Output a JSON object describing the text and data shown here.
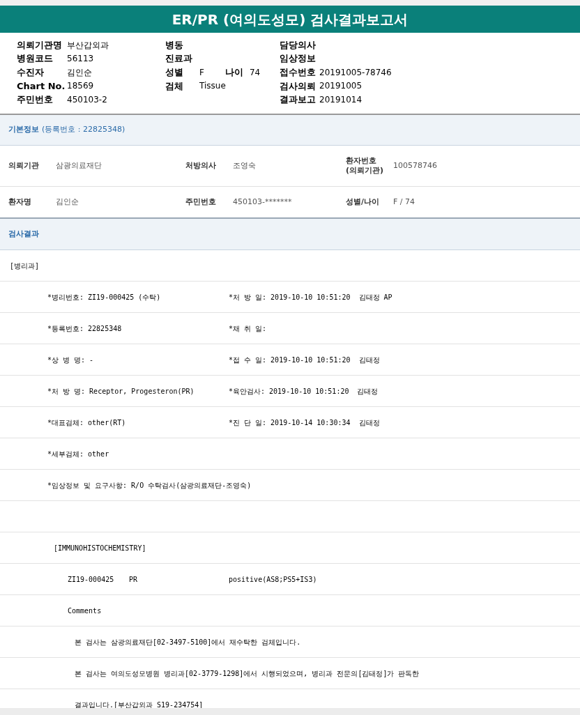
{
  "title": "ER/PR (여의도성모) 검사결과보고서",
  "header": {
    "rows": [
      [
        {
          "label": "의뢰기관명",
          "value": "부산갑외과"
        },
        {
          "label": "병동"
        },
        {
          "label": "담당의사"
        }
      ],
      [
        {
          "label": "병원코드",
          "value": "56113"
        },
        {
          "label": "진료과"
        },
        {
          "label": "임상정보"
        }
      ],
      [
        {
          "label": "수진자",
          "value": "김인순"
        },
        {
          "label": "성별",
          "value": "F",
          "extra_label": "나이",
          "extra_value": "74"
        },
        {
          "label": "접수번호",
          "value": "20191005-78746"
        }
      ],
      [
        {
          "label": "Chart No.",
          "value": "18569"
        },
        {
          "label": "검체",
          "value": "Tissue"
        },
        {
          "label": "검사의뢰",
          "value": "20191005"
        }
      ],
      [
        {
          "label": "주민번호",
          "value": "450103-2"
        },
        {},
        {
          "label": "결과보고",
          "value": "20191014"
        }
      ]
    ]
  },
  "basic_info": {
    "heading": "기본정보",
    "note": "(등록번호 : 22825348)",
    "rows": [
      [
        {
          "label": "의뢰기관",
          "value": "삼광의료재단"
        },
        {
          "label": "처방의사",
          "value": "조영숙"
        },
        {
          "label": "환자번호\n(의뢰기관)",
          "value": "100578746"
        }
      ],
      [
        {
          "label": "환자명",
          "value": "김인순"
        },
        {
          "label": "주민번호",
          "value": "450103-*******"
        },
        {
          "label": "성별/나이",
          "value": "F / 74"
        }
      ]
    ]
  },
  "results": {
    "heading": "검사결과",
    "lines": [
      {
        "kind": "department",
        "text": "[병리과]"
      },
      {
        "kind": "pair",
        "left": "*병리번호: ZI19-000425 (수탁)",
        "right": "*처 방 일: 2019-10-10 10:51:20  김태정 AP"
      },
      {
        "kind": "pair",
        "left": "*등록번호: 22825348",
        "right": "*채 취 일:"
      },
      {
        "kind": "pair",
        "left": "*상 병 명: -",
        "right": "*접 수 일: 2019-10-10 10:51:20  김태정"
      },
      {
        "kind": "pair",
        "left": "*처 방 명: Receptor, Progesteron(PR)",
        "right": "*육안검사: 2019-10-10 10:51:20  김태정"
      },
      {
        "kind": "pair",
        "left": "*대표검체: other(RT)",
        "right": "*진 단 일: 2019-10-14 10:30:34  김태정"
      },
      {
        "kind": "pair",
        "left": "*세부검체: other"
      },
      {
        "kind": "pair",
        "left": "*임상정보 및 요구사항: R/O 수탁검사(삼광의료재단-조영숙)"
      },
      {
        "kind": "blank"
      },
      {
        "kind": "group",
        "text": "[IMMUNOHISTOCHEMISTRY]"
      },
      {
        "kind": "result",
        "cells": [
          "ZI19-000425",
          "PR",
          "positive(AS8;PS5+IS3)"
        ]
      },
      {
        "kind": "subheading",
        "text": "Comments"
      },
      {
        "kind": "comment",
        "text": "본 검사는 삼광의료재단[02-3497-5100]에서 재수탁한 검체입니다."
      },
      {
        "kind": "comment",
        "text": "본 검사는 여의도성모병원 병리과[02-3779-1298]에서 시행되었으며, 병리과 전문의[김태정]가 판독한"
      },
      {
        "kind": "comment",
        "text": "결과입니다.[부산갑외과 S19-234754]"
      }
    ]
  }
}
